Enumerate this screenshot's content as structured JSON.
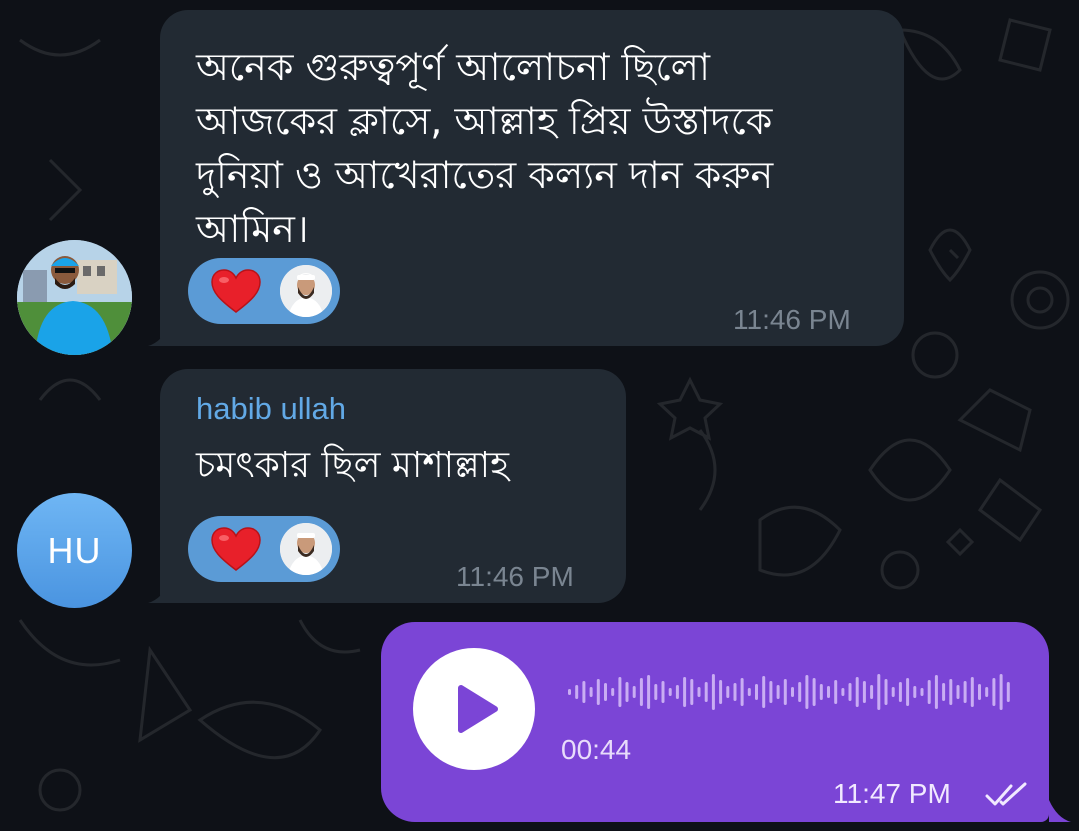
{
  "messages": [
    {
      "text": "অনেক গুরুত্বপূর্ণ আলোচনা ছিলো\nআজকের ক্লাসে, আল্লাহ প্রিয় উস্তাদকে\nদুনিয়া ও আখেরাতের কল্যন দান করুন\nআমিন।",
      "time": "11:46 PM",
      "reaction": "heart-icon"
    },
    {
      "sender": "habib ullah",
      "sender_initials": "HU",
      "text": "চমৎকার ছিল  মাশাল্লাহ",
      "time": "11:46 PM",
      "reaction": "heart-icon"
    }
  ],
  "voice_message": {
    "duration": "00:44",
    "time": "11:47 PM",
    "status_icon": "double-check-icon"
  },
  "colors": {
    "background": "#0e1117",
    "incoming_bubble": "#222a33",
    "outgoing_bubble": "#7b45d6",
    "sender_name": "#62a9e6",
    "reaction_pill": "#5b9bd6",
    "heart": "#e8202a"
  }
}
